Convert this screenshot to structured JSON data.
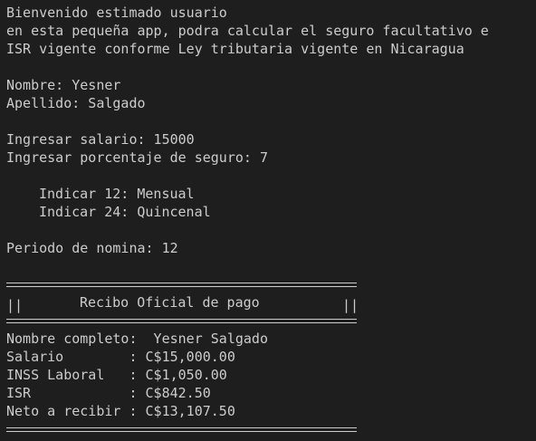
{
  "intro": {
    "line1": "Bienvenido estimado usuario",
    "line2": "en esta pequeña app, podra calcular el seguro facultativo e",
    "line3": "ISR vigente conforme Ley tributaria vigente en Nicaragua"
  },
  "user": {
    "nombre": "Nombre: Yesner",
    "apellido": "Apellido: Salgado"
  },
  "inputs": {
    "salario": "Ingresar salario: 15000",
    "porcentaje": "Ingresar porcentaje de seguro: 7"
  },
  "options": {
    "mensual": "Indicar 12: Mensual",
    "quincenal": "Indicar 24: Quincenal"
  },
  "periodo": "Periodo de nomina: 12",
  "receipt": {
    "border_left": "||",
    "title": "Recibo Oficial de pago",
    "border_right": "||",
    "nombre_completo": "Nombre completo:  Yesner Salgado",
    "salario": "Salario        : C$15,000.00",
    "inss": "INSS Laboral   : C$1,050.00",
    "isr": "ISR            : C$842.50",
    "neto": "Neto a recibir : C$13,107.50"
  },
  "colors": {
    "background": "#1e1e1e",
    "text": "#cccccc"
  }
}
